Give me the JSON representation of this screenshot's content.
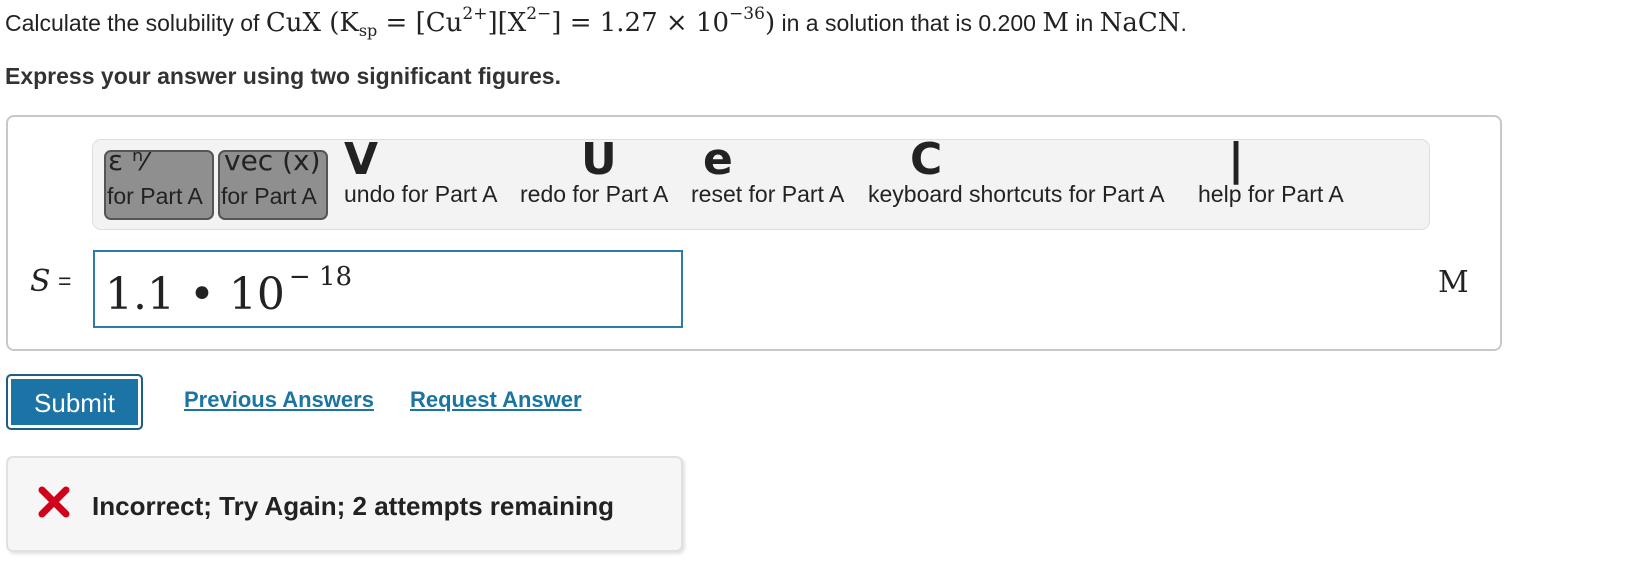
{
  "question": {
    "prefix": "Calculate the solubility of ",
    "compound": "CuX",
    "ksp_open": "(K",
    "ksp_sub": "sp",
    "ksp_eq1": " = [Cu",
    "cu_charge": "2+",
    "ksp_mid": "][X",
    "x_charge": "2−",
    "ksp_eq2": "] = 1.27 × 10",
    "ksp_exp": "−36",
    "ksp_close": ")",
    "suffix_1": " in a solution that is 0.200 ",
    "molar_unit": "M",
    "suffix_2": " in ",
    "salt": "NaCN",
    "suffix_3": "."
  },
  "instruction": "Express your answer using two significant figures.",
  "toolbar": {
    "buttons": [
      {
        "label": "for Part A",
        "glyph": "ε ⁿ⁄"
      },
      {
        "label": "for Part A",
        "glyph": "vec (x)"
      },
      {
        "label": "undo for Part A",
        "glyph": "V"
      },
      {
        "label": "redo for Part A",
        "glyph": "C"
      },
      {
        "label": "reset for Part A",
        "glyph": "U"
      },
      {
        "label": "keyboard shortcuts for Part A",
        "glyph": "e"
      },
      {
        "label": "help for Part A",
        "glyph": "|"
      }
    ]
  },
  "answer": {
    "variable": "S",
    "equals": "=",
    "mantissa": "1.1 • 10",
    "exponent": "− 18",
    "unit": "M"
  },
  "actions": {
    "submit": "Submit",
    "previous_answers": "Previous Answers",
    "request_answer": "Request Answer"
  },
  "feedback": {
    "message": "Incorrect; Try Again; 2 attempts remaining",
    "status_color": "#d0021b"
  },
  "colors": {
    "accent": "#1b73a6",
    "link": "#1a75a3",
    "input_border": "#2e7ca5"
  }
}
